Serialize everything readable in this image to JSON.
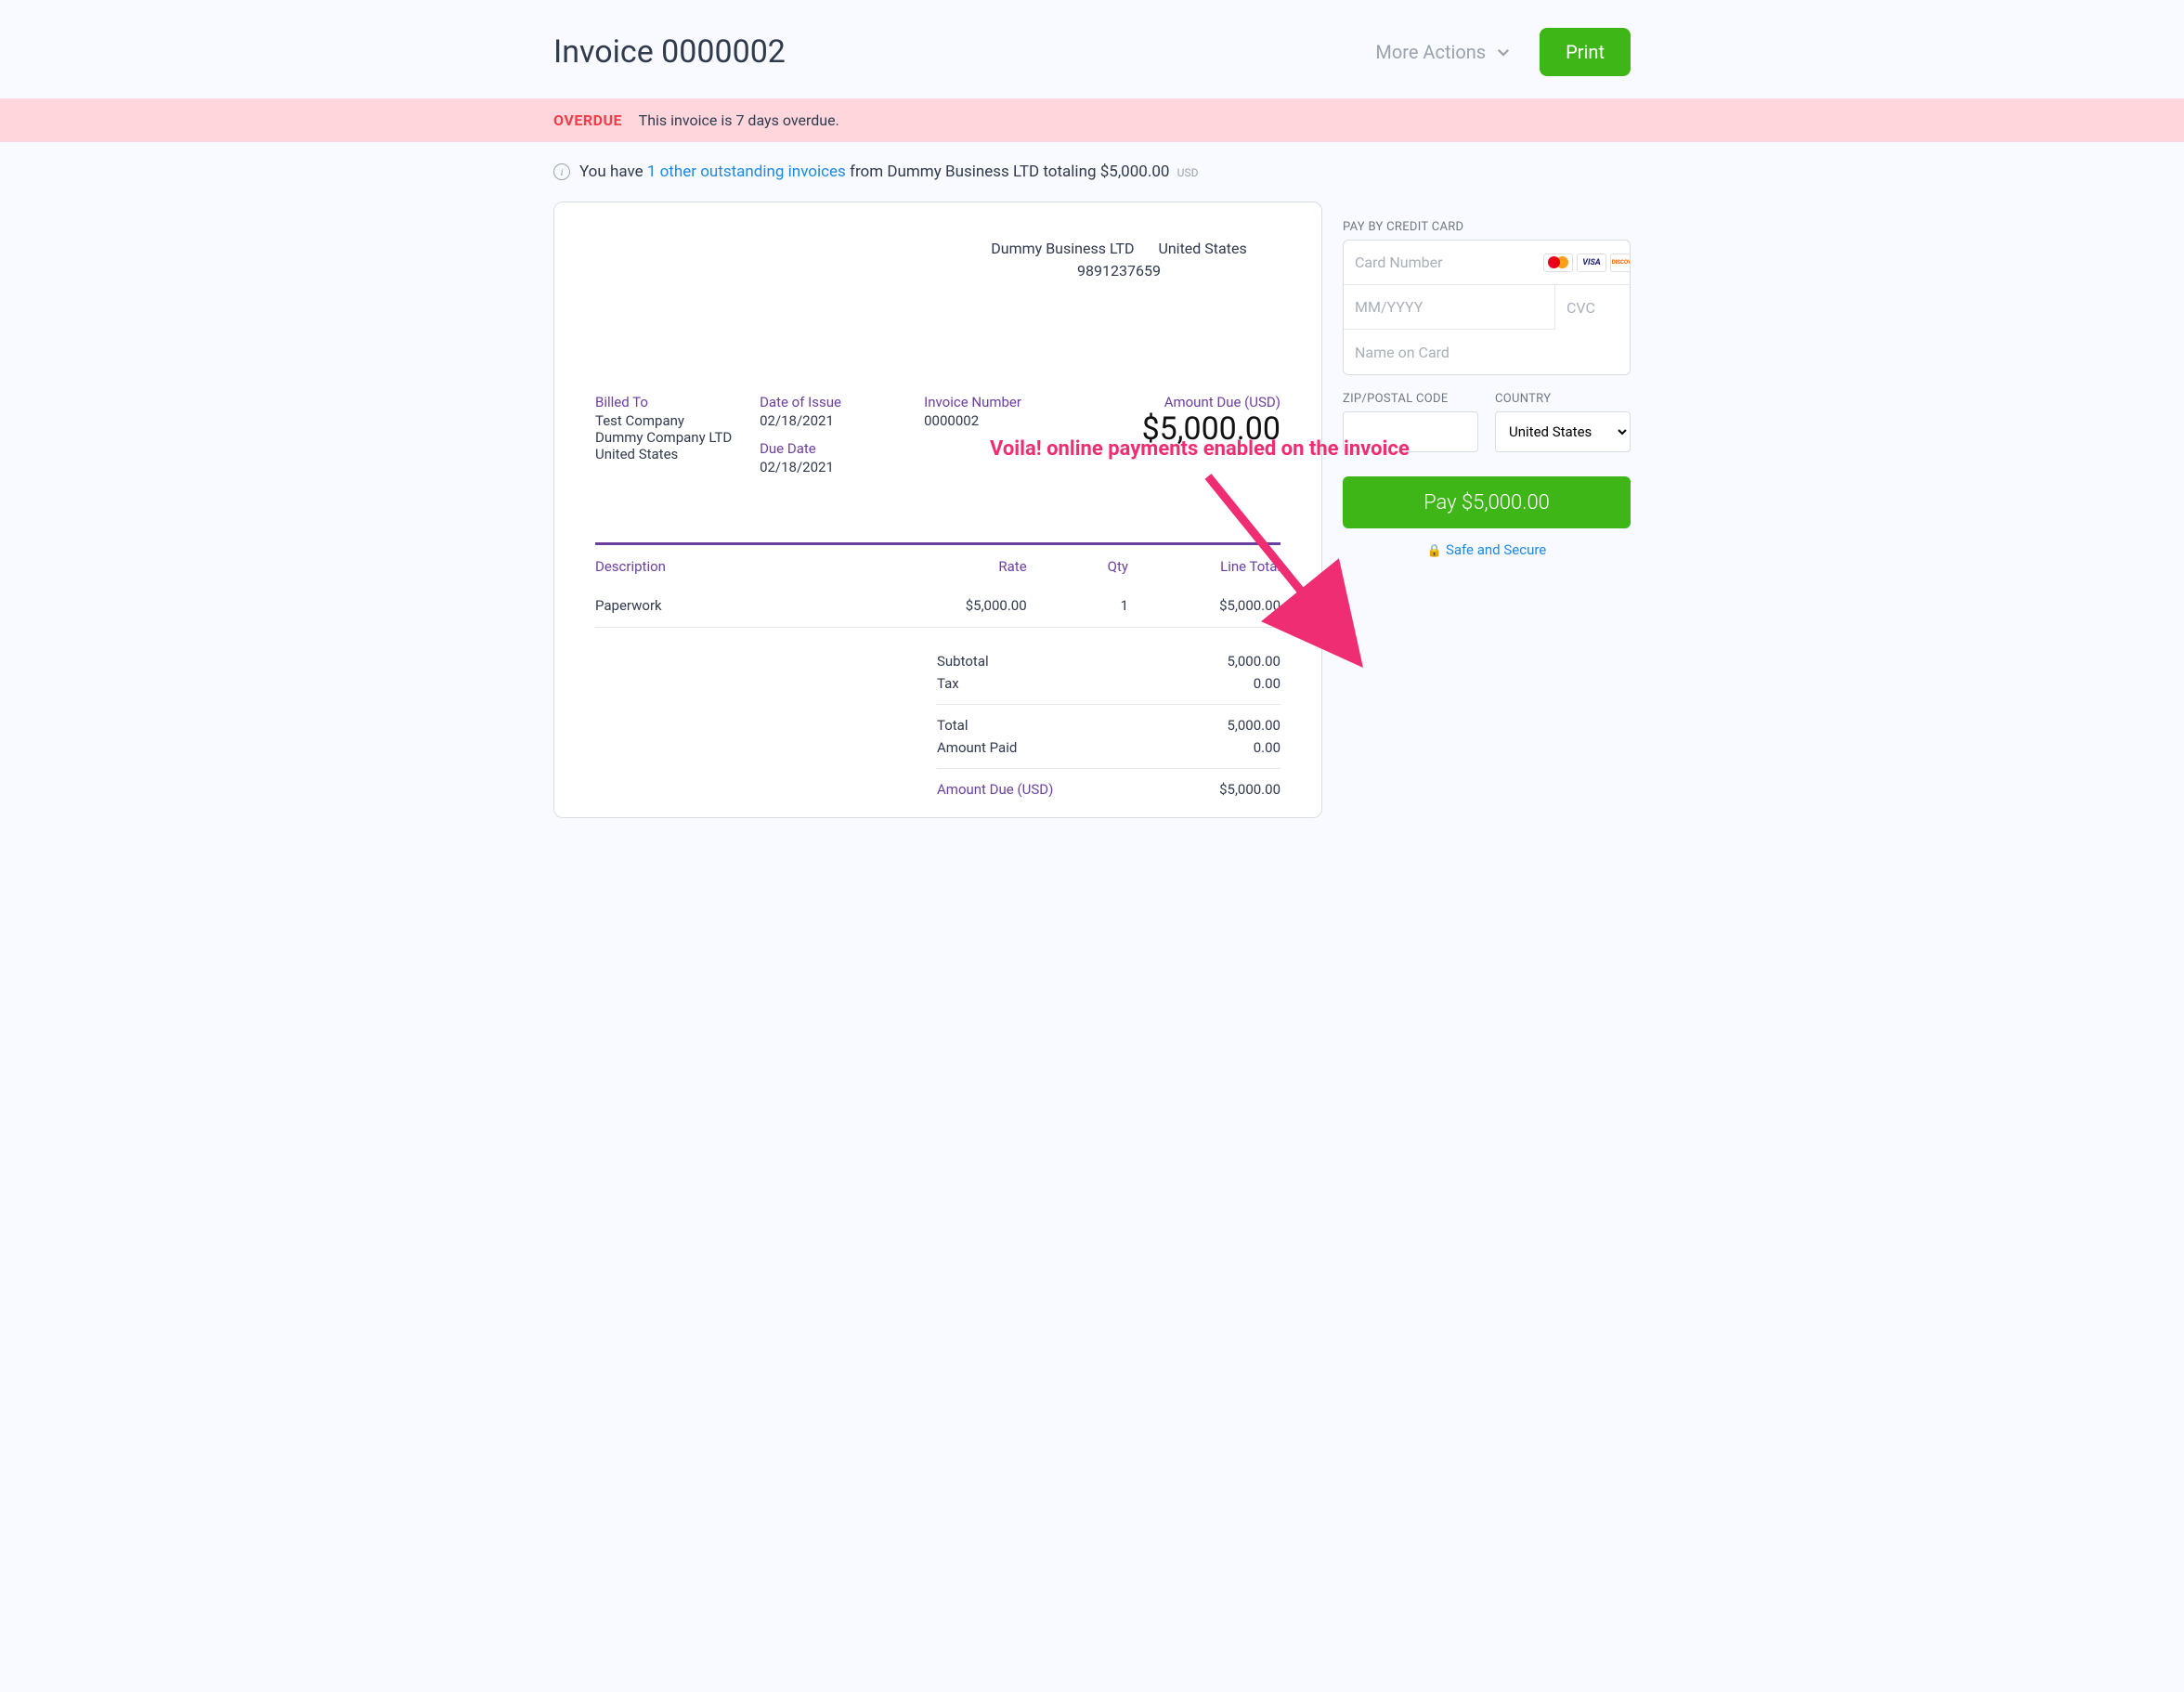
{
  "header": {
    "title": "Invoice 0000002",
    "more_actions": "More Actions",
    "print": "Print"
  },
  "overdue": {
    "label": "OVERDUE",
    "message": "This invoice is 7 days overdue."
  },
  "outstanding": {
    "prefix": "You have ",
    "link": "1 other outstanding invoices",
    "suffix": " from Dummy Business LTD totaling $5,000.00",
    "currency": "USD"
  },
  "business": {
    "name": "Dummy Business LTD",
    "country": "United States",
    "phone": "9891237659"
  },
  "billed_to": {
    "label": "Billed To",
    "line1": "Test Company",
    "line2": "Dummy Company LTD",
    "line3": "United States"
  },
  "dates": {
    "issue_label": "Date of Issue",
    "issue_value": "02/18/2021",
    "due_label": "Due Date",
    "due_value": "02/18/2021"
  },
  "invoice_meta": {
    "number_label": "Invoice Number",
    "number_value": "0000002",
    "amount_due_label": "Amount Due (USD)",
    "amount_due_value": "$5,000.00"
  },
  "table": {
    "headers": {
      "desc": "Description",
      "rate": "Rate",
      "qty": "Qty",
      "total": "Line Total"
    },
    "rows": [
      {
        "desc": "Paperwork",
        "rate": "$5,000.00",
        "qty": "1",
        "total": "$5,000.00"
      }
    ]
  },
  "summary": {
    "subtotal_label": "Subtotal",
    "subtotal_value": "5,000.00",
    "tax_label": "Tax",
    "tax_value": "0.00",
    "total_label": "Total",
    "total_value": "5,000.00",
    "paid_label": "Amount Paid",
    "paid_value": "0.00",
    "due_label": "Amount Due (USD)",
    "due_value": "$5,000.00"
  },
  "payment": {
    "header": "PAY BY CREDIT CARD",
    "card_placeholder": "Card Number",
    "exp_placeholder": "MM/YYYY",
    "cvc_placeholder": "CVC",
    "name_placeholder": "Name on Card",
    "zip_label": "ZIP/POSTAL CODE",
    "country_label": "COUNTRY",
    "country_value": "United States",
    "pay_button": "Pay $5,000.00",
    "safe_text": "Safe and Secure"
  },
  "annotation": "Voila!  online payments enabled on the invoice"
}
